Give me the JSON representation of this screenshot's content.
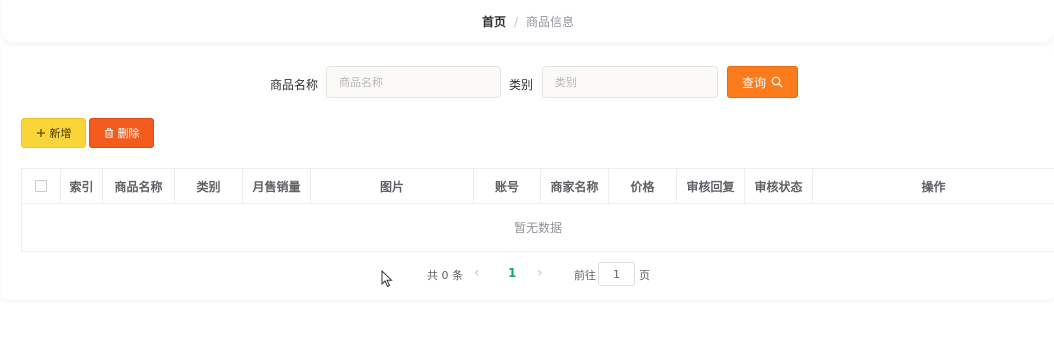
{
  "breadcrumb": {
    "home": "首页",
    "separator": "/",
    "current": "商品信息"
  },
  "search": {
    "name_label": "商品名称",
    "name_placeholder": "商品名称",
    "category_label": "类别",
    "category_placeholder": "类别",
    "button_label": "查询",
    "button_icon": "search-icon"
  },
  "actions": {
    "add_label": "新增",
    "add_icon": "plus-icon",
    "delete_label": "删除",
    "delete_icon": "trash-icon"
  },
  "table": {
    "columns": [
      "索引",
      "商品名称",
      "类别",
      "月售销量",
      "图片",
      "账号",
      "商家名称",
      "价格",
      "审核回复",
      "审核状态",
      "操作"
    ],
    "empty_text": "暂无数据"
  },
  "pagination": {
    "total_text": "共 0 条",
    "current_page": "1",
    "goto_label": "前往",
    "goto_value": "1",
    "page_suffix": "页"
  },
  "colors": {
    "search_button": "#fb7a1c",
    "add_button": "#f9d53a",
    "delete_button": "#f25b1c",
    "active_page": "#17a37a"
  }
}
